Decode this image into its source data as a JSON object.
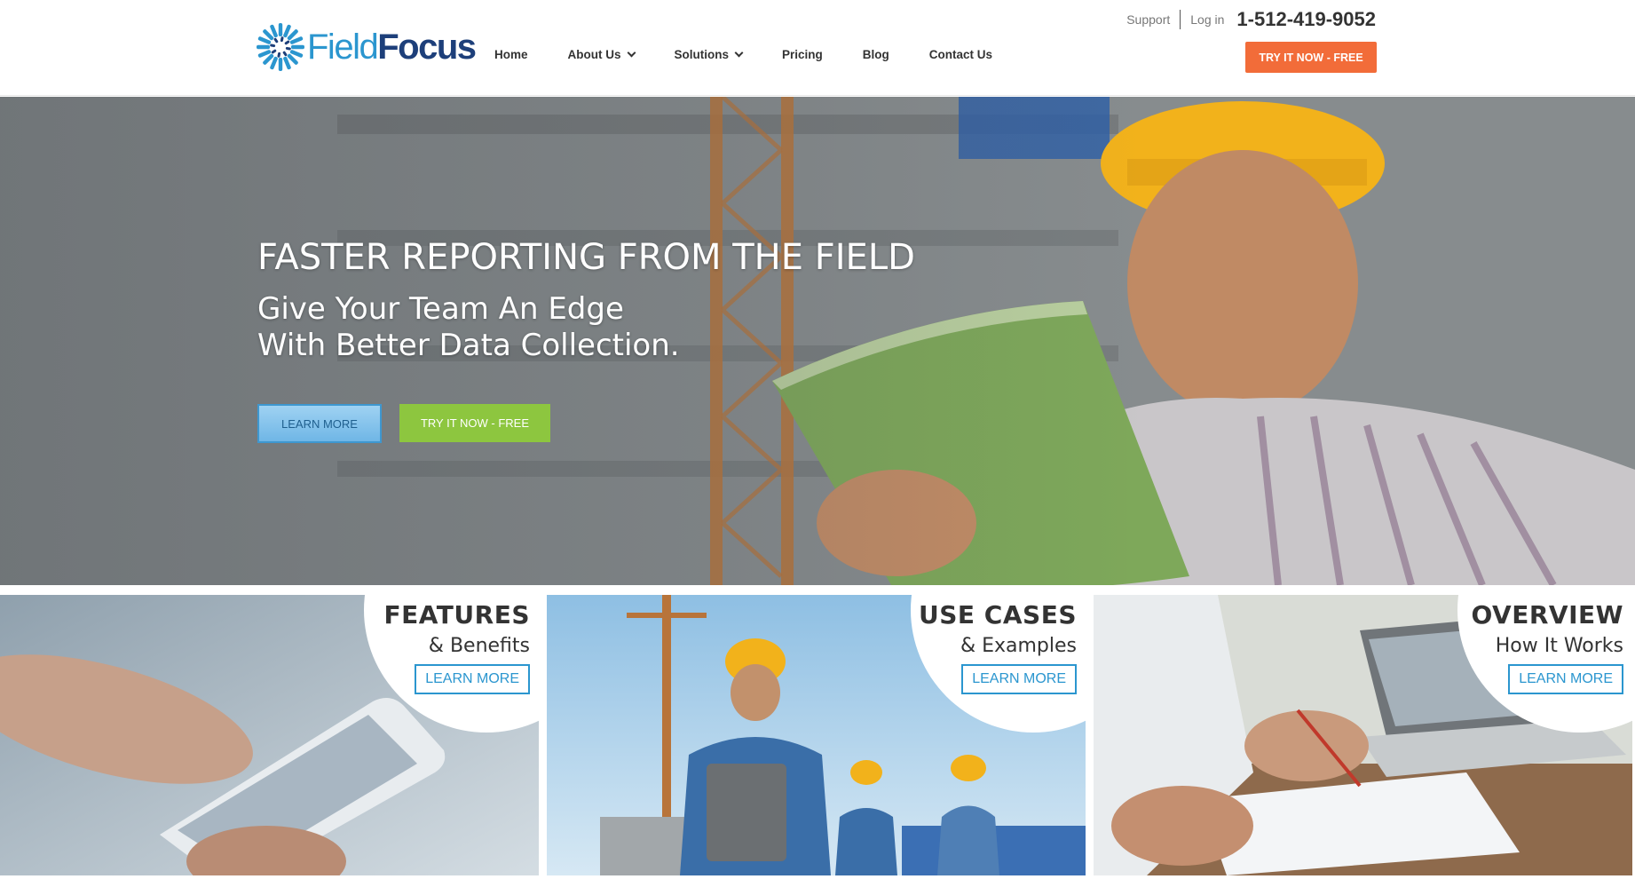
{
  "brand": {
    "name_part1": "Field",
    "name_part2": "Focus",
    "primary": "#2b96cf",
    "dark": "#1d3f7a",
    "accent": "#f26c39",
    "green": "#8dc63f"
  },
  "topbar": {
    "support": "Support",
    "login": "Log in",
    "phone": "1-512-419-9052"
  },
  "nav": {
    "items": [
      {
        "label": "Home"
      },
      {
        "label": "About Us"
      },
      {
        "label": "Solutions"
      },
      {
        "label": "Pricing"
      },
      {
        "label": "Blog"
      },
      {
        "label": "Contact Us"
      }
    ],
    "cta": "TRY IT NOW - FREE"
  },
  "hero": {
    "title": "FASTER REPORTING FROM THE FIELD",
    "subtitle_line1": "Give Your Team An Edge",
    "subtitle_line2": "With Better Data Collection.",
    "learn_more": "LEARN MORE",
    "try_now": "TRY IT NOW - FREE"
  },
  "cards": [
    {
      "heading": "FEATURES",
      "sub": "& Benefits",
      "button": "LEARN MORE"
    },
    {
      "heading": "USE CASES",
      "sub": "& Examples",
      "button": "LEARN MORE"
    },
    {
      "heading": "OVERVIEW",
      "sub": "How It Works",
      "button": "LEARN MORE"
    }
  ]
}
